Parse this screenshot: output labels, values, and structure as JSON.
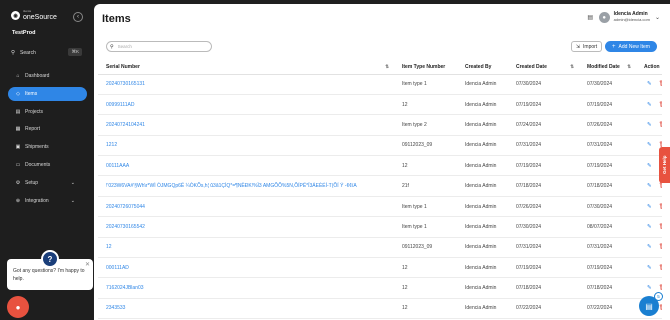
{
  "sidebar": {
    "brand_small": "Idencia",
    "brand_name": "oneSource",
    "org": "TestProd",
    "search_label": "Search",
    "search_shortcut": "⌘K",
    "items": [
      {
        "label": "Dashboard",
        "icon": "home-icon"
      },
      {
        "label": "Items",
        "icon": "tag-icon",
        "active": true
      },
      {
        "label": "Projects",
        "icon": "document-icon"
      },
      {
        "label": "Report",
        "icon": "report-icon"
      },
      {
        "label": "Shipments",
        "icon": "shipment-icon"
      },
      {
        "label": "Documents",
        "icon": "folder-icon"
      },
      {
        "label": "Setup",
        "icon": "gear-icon",
        "expandable": true
      },
      {
        "label": "Integration",
        "icon": "integration-icon",
        "expandable": true
      }
    ]
  },
  "chat": {
    "message": "Got any questions? I'm happy to help."
  },
  "header": {
    "title": "Items",
    "user_name": "Idencia Admin",
    "user_email": "admin@idencia.com"
  },
  "toolbar": {
    "search_placeholder": "Search",
    "import_label": "Import",
    "add_label": "Add New Item"
  },
  "table": {
    "columns": [
      "Serial Number",
      "Item Type Number",
      "Created By",
      "Created Date",
      "Modified Date",
      "Action"
    ],
    "rows": [
      {
        "serial": "20240730165131",
        "type": "Item type 1",
        "created_by": "Idencia Admin",
        "created": "07/30/2024",
        "modified": "07/30/2024"
      },
      {
        "serial": "00999111AD",
        "type": "12",
        "created_by": "Idencia Admin",
        "created": "07/19/2024",
        "modified": "07/19/2024"
      },
      {
        "serial": "20240724104241",
        "type": "Item type 2",
        "created_by": "Idencia Admin",
        "created": "07/24/2024",
        "modified": "07/26/2024"
      },
      {
        "serial": "1212",
        "type": "09112023_09",
        "created_by": "Idencia Admin",
        "created": "07/31/2024",
        "modified": "07/31/2024"
      },
      {
        "serial": "00111AAA",
        "type": "12",
        "created_by": "Idencia Admin",
        "created": "07/19/2024",
        "modified": "07/19/2024"
      },
      {
        "serial": "!'023W6VA#'§Wh\\r*WÌ ÒJMGQp6Ë ¼ÒKÕs,h¦ ŭ3ã1ÇÌQ*=¶NËÐK!%Ï3 AMGÕÕ%5N,ÕÍPË*Ï3ÁEÈÉÍ-T(ÕÍ Ý -¢¢íA",
        "type": "21f",
        "created_by": "Idencia Admin",
        "created": "07/18/2024",
        "modified": "07/18/2024"
      },
      {
        "serial": "20240726075044",
        "type": "Item type 1",
        "created_by": "Idencia Admin",
        "created": "07/26/2024",
        "modified": "07/30/2024"
      },
      {
        "serial": "20240730165542",
        "type": "Item type 1",
        "created_by": "Idencia Admin",
        "created": "07/30/2024",
        "modified": "08/07/2024"
      },
      {
        "serial": "12",
        "type": "09112023_09",
        "created_by": "Idencia Admin",
        "created": "07/31/2024",
        "modified": "07/31/2024"
      },
      {
        "serial": "000111AD",
        "type": "12",
        "created_by": "Idencia Admin",
        "created": "07/19/2024",
        "modified": "07/19/2024"
      },
      {
        "serial": "7162024JBlan03",
        "type": "12",
        "created_by": "Idencia Admin",
        "created": "07/18/2024",
        "modified": "07/18/2024"
      },
      {
        "serial": "2343533",
        "type": "12",
        "created_by": "Idencia Admin",
        "created": "07/22/2024",
        "modified": "07/22/2024"
      }
    ]
  },
  "widgets": {
    "side_tab": "Get Help",
    "fab_badge": "5"
  },
  "colors": {
    "accent": "#2f86e6",
    "sidebar_bg": "#1e1e1e",
    "danger": "#e04a3f",
    "chat_launcher": "#e8523f"
  }
}
